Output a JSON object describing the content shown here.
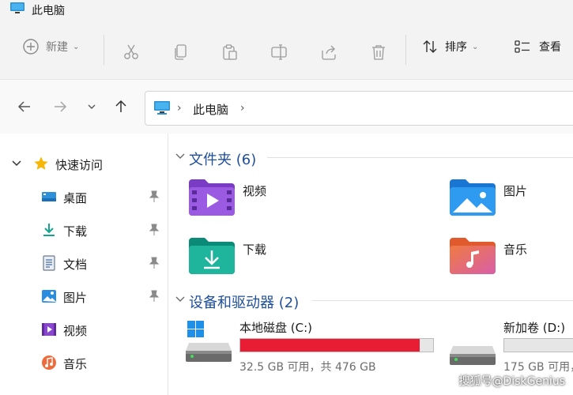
{
  "window": {
    "title": "此电脑"
  },
  "toolbar": {
    "new_label": "新建",
    "sort_label": "排序",
    "view_label": "查看"
  },
  "address": {
    "path": "此电脑"
  },
  "sidebar": {
    "quick_access": "快速访问",
    "items": [
      {
        "label": "桌面",
        "icon": "desktop-icon"
      },
      {
        "label": "下载",
        "icon": "download-icon"
      },
      {
        "label": "文档",
        "icon": "document-icon"
      },
      {
        "label": "图片",
        "icon": "picture-icon"
      },
      {
        "label": "视频",
        "icon": "video-icon"
      },
      {
        "label": "音乐",
        "icon": "music-icon"
      }
    ]
  },
  "main": {
    "folders_header": "文件夹 (6)",
    "folders": [
      {
        "label": "视频"
      },
      {
        "label": "图片"
      },
      {
        "label": "下载"
      },
      {
        "label": "音乐"
      }
    ],
    "drives_header": "设备和驱动器 (2)",
    "drives": [
      {
        "name": "本地磁盘 (C:)",
        "space": "32.5 GB 可用，共 476 GB",
        "used_fraction": 0.93,
        "bar_color": "#e81c32"
      },
      {
        "name": "新加卷 (D:)",
        "space": "175 GB 可用，",
        "used_fraction": 0.0,
        "bar_color": "#26a0da"
      }
    ]
  },
  "watermark": "搜狐号@DiskGenius",
  "colors": {
    "accent": "#1f4e9a",
    "danger_bar": "#e81c32"
  }
}
